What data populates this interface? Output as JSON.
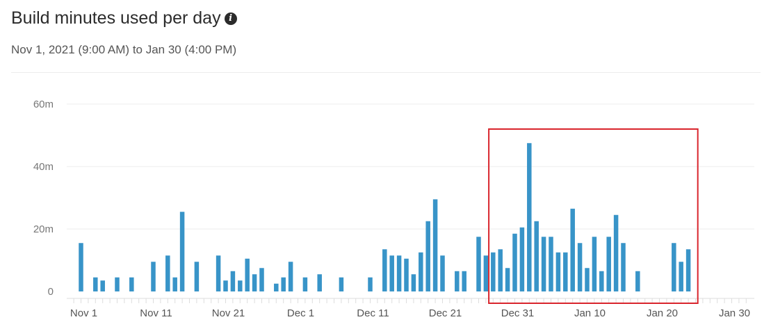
{
  "header": {
    "title": "Build minutes used per day",
    "info_icon": "info-icon",
    "subtitle": "Nov 1, 2021 (9:00 AM) to Jan 30 (4:00 PM)"
  },
  "colors": {
    "bar": "#3894c8",
    "highlight": "#d9242c",
    "grid": "#eeeeee",
    "axis": "#dddddd"
  },
  "chart_data": {
    "type": "bar",
    "title": "Build minutes used per day",
    "xlabel": "",
    "ylabel": "",
    "ylim": [
      0,
      60
    ],
    "y_ticks": [
      "0",
      "20m",
      "40m",
      "60m"
    ],
    "y_tick_values": [
      0,
      20,
      40,
      60
    ],
    "x_tick_labels": [
      "Nov 1",
      "Nov 11",
      "Nov 21",
      "Dec 1",
      "Dec 11",
      "Dec 21",
      "Dec 31",
      "Jan 10",
      "Jan 20",
      "Jan 30"
    ],
    "x_tick_days": [
      0,
      10,
      20,
      30,
      40,
      50,
      60,
      70,
      80,
      90
    ],
    "unit": "minutes",
    "days": [
      0,
      2,
      3,
      5,
      7,
      10,
      12,
      13,
      14,
      16,
      19,
      20,
      21,
      22,
      23,
      24,
      25,
      27,
      28,
      29,
      31,
      33,
      36,
      40,
      42,
      43,
      44,
      45,
      46,
      47,
      48,
      49,
      50,
      52,
      53,
      55,
      56,
      57,
      58,
      59,
      60,
      61,
      62,
      63,
      64,
      65,
      66,
      67,
      68,
      69,
      70,
      71,
      72,
      73,
      74,
      75,
      77,
      82,
      83,
      84,
      90
    ],
    "values": [
      15.5,
      4.5,
      3.5,
      4.5,
      4.5,
      9.5,
      11.5,
      4.5,
      25.5,
      9.5,
      11.5,
      3.5,
      6.5,
      3.5,
      10.5,
      5.5,
      7.5,
      2.5,
      4.5,
      9.5,
      4.5,
      5.5,
      4.5,
      4.5,
      13.5,
      11.5,
      11.5,
      10.5,
      5.5,
      12.5,
      22.5,
      29.5,
      11.5,
      6.5,
      6.5,
      17.5,
      11.5,
      12.5,
      13.5,
      7.5,
      18.5,
      20.5,
      47.5,
      22.5,
      17.5,
      17.5,
      12.5,
      12.5,
      26.5,
      15.5,
      7.5,
      17.5,
      6.5,
      17.5,
      24.5,
      15.5,
      6.5,
      15.5,
      9.5,
      13.5
    ],
    "highlight_range_days": [
      56.5,
      85.5
    ]
  }
}
